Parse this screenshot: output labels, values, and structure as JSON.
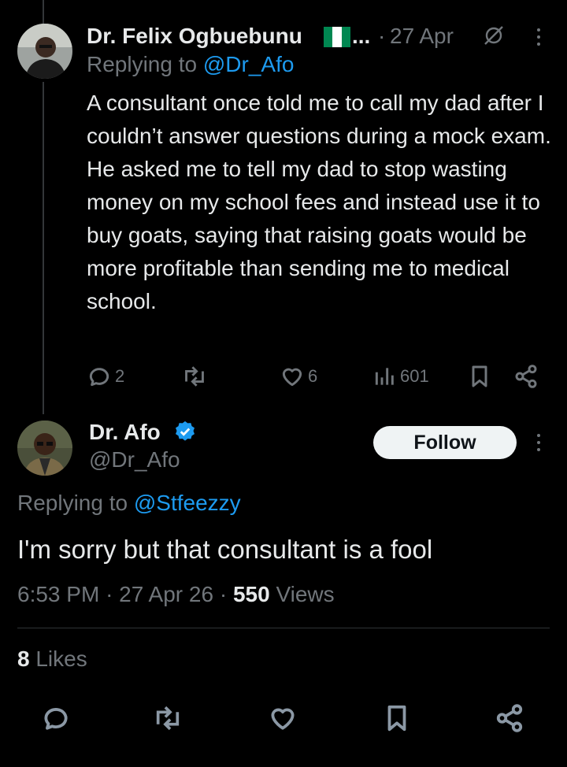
{
  "reply_tweet": {
    "author_name": "Dr. Felix Ogbuebunu",
    "name_suffix": "...",
    "dot": "·",
    "date": "27 Apr",
    "replying_prefix": "Replying to",
    "replying_handle": "@Dr_Afo",
    "body": "A consultant once told me to call my dad after I couldn’t answer questions during a mock exam. He asked me to tell my dad to stop wasting money on my school fees and instead use it to buy goats, saying that raising goats would be more profitable than sending me to medical school.",
    "replies": "2",
    "likes": "6",
    "views": "601"
  },
  "main_tweet": {
    "author_name": "Dr. Afo",
    "handle": "@Dr_Afo",
    "follow_label": "Follow",
    "replying_prefix": "Replying to",
    "replying_handle": "@Stfeezzy",
    "body": "I'm sorry but that consultant is a fool",
    "time": "6:53 PM",
    "dot": "·",
    "date": "27 Apr 26",
    "views_count": "550",
    "views_label": "Views",
    "likes_count": "8",
    "likes_label": "Likes"
  },
  "icons": [
    "reply-icon",
    "retweet-icon",
    "like-icon",
    "views-icon",
    "bookmark-icon",
    "share-icon",
    "verified-icon",
    "mute-icon",
    "more-icon",
    "nigeria-flag-icon"
  ],
  "colors": {
    "background": "#000000",
    "text": "#e7e9ea",
    "muted": "#71767b",
    "link": "#1d9bf0",
    "verified": "#1d9bf0",
    "follow_bg": "#eff3f4"
  }
}
